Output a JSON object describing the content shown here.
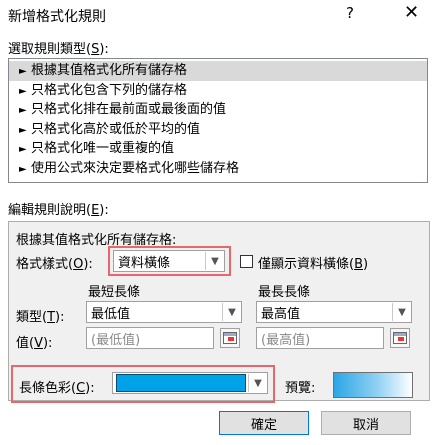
{
  "dialog": {
    "title": "新增格式化規則",
    "help_glyph": "?",
    "close_glyph": "✕"
  },
  "select_rule_type": {
    "label_prefix": "選取規則類型(",
    "label_key": "S",
    "label_suffix": "):",
    "items": [
      {
        "label": "根據其值格式化所有儲存格",
        "selected": true
      },
      {
        "label": "只格式化包含下列的儲存格",
        "selected": false
      },
      {
        "label": "只格式化排在最前面或最後面的值",
        "selected": false
      },
      {
        "label": "只格式化高於或低於平均的值",
        "selected": false
      },
      {
        "label": "只格式化唯一或重複的值",
        "selected": false
      },
      {
        "label": "使用公式來決定要格式化哪些儲存格",
        "selected": false
      }
    ]
  },
  "edit_rule": {
    "label_prefix": "編輯規則說明(",
    "label_key": "E",
    "label_suffix": "):",
    "heading": "根據其值格式化所有儲存格:",
    "format_style_prefix": "格式樣式(",
    "format_style_key": "O",
    "format_style_suffix": "):",
    "format_style_value": "資料橫條",
    "show_bar_only_prefix": "僅顯示資料橫條(",
    "show_bar_only_key": "B",
    "show_bar_only_suffix": ")",
    "show_bar_only_checked": false,
    "min_header": "最短長條",
    "max_header": "最長長條",
    "type_prefix": "類型(",
    "type_key": "T",
    "type_suffix": "):",
    "min_type": "最低值",
    "max_type": "最高值",
    "value_prefix": "值(",
    "value_key": "V",
    "value_suffix": "):",
    "min_value_placeholder": "(最低值)",
    "max_value_placeholder": "(最高值)",
    "bar_color_prefix": "長條色彩(",
    "bar_color_key": "C",
    "bar_color_suffix": "):",
    "bar_color": "#00a2e8",
    "preview_label": "預覽:"
  },
  "buttons": {
    "ok": "確定",
    "cancel": "取消"
  },
  "colors": {
    "highlight_border": "#e8676a",
    "selected_row": "#d9d9d9",
    "bar_color": "#00a2e8"
  }
}
